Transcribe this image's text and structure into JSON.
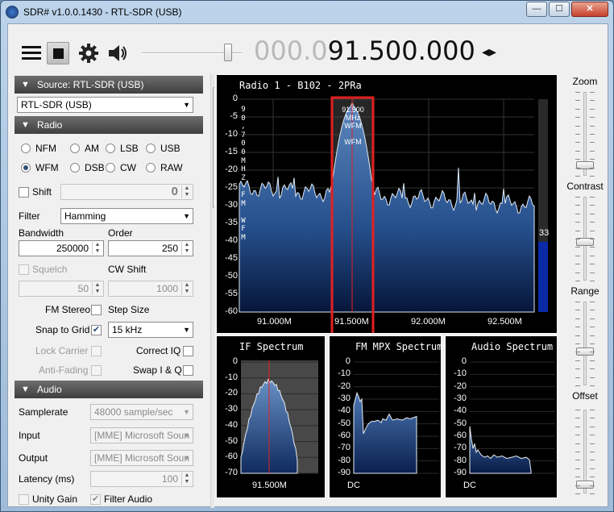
{
  "window": {
    "title": "SDR# v1.0.0.1430 - RTL-SDR (USB)"
  },
  "toolbar": {
    "freq_dim": "000.0",
    "freq_bright": "91.500.000",
    "freq_arrows": "◂▸"
  },
  "source": {
    "header": "Source: RTL-SDR (USB)",
    "device": "RTL-SDR (USB)"
  },
  "radio": {
    "header": "Radio",
    "modes": [
      "NFM",
      "AM",
      "LSB",
      "USB",
      "WFM",
      "DSB",
      "CW",
      "RAW"
    ],
    "selected_mode": "WFM",
    "shift_label": "Shift",
    "shift_value": "0",
    "filter_label": "Filter",
    "filter_value": "Hamming",
    "bandwidth_label": "Bandwidth",
    "bandwidth_value": "250000",
    "order_label": "Order",
    "order_value": "250",
    "squelch_label": "Squelch",
    "squelch_value": "50",
    "cwshift_label": "CW Shift",
    "cwshift_value": "1000",
    "fmstereo_label": "FM Stereo",
    "stepsize_label": "Step Size",
    "snap_label": "Snap to Grid",
    "stepsize_value": "15 kHz",
    "lockcarrier_label": "Lock Carrier",
    "correctiq_label": "Correct IQ",
    "antifading_label": "Anti-Fading",
    "swapiq_label": "Swap I & Q"
  },
  "audio": {
    "header": "Audio",
    "samplerate_label": "Samplerate",
    "samplerate_value": "48000 sample/sec",
    "input_label": "Input",
    "input_value": "[MME] Microsoft Soun",
    "output_label": "Output",
    "output_value": "[MME] Microsoft Soun",
    "latency_label": "Latency (ms)",
    "latency_value": "100",
    "unitygain_label": "Unity Gain",
    "filteraudio_label": "Filter Audio"
  },
  "main_spectrum": {
    "title": "Radio 1  - B102 - 2PRa",
    "y_ticks": [
      "0",
      "-5",
      "-10",
      "-15",
      "-20",
      "-25",
      "-30",
      "-35",
      "-40",
      "-45",
      "-50",
      "-55",
      "-60"
    ],
    "x_ticks": [
      "91.000M",
      "91.500M",
      "92.000M",
      "92.500M"
    ],
    "side_text": [
      "9",
      "0",
      ",",
      "7",
      "0",
      "0",
      "M",
      "H",
      "Z",
      "-",
      "F",
      "M",
      " ",
      "W",
      "F",
      "M"
    ],
    "marker_lines": [
      "91.500",
      "MHz",
      "WFM",
      "",
      "WFM"
    ],
    "level_value": "33",
    "level_fraction": 0.33
  },
  "if_spectrum": {
    "title": "IF Spectrum",
    "y_ticks": [
      "0",
      "-10",
      "-20",
      "-30",
      "-40",
      "-50",
      "-60",
      "-70"
    ],
    "x_label": "91.500M"
  },
  "mpx_spectrum": {
    "title": "FM MPX Spectrum",
    "y_ticks": [
      "0",
      "-10",
      "-20",
      "-30",
      "-40",
      "-50",
      "-60",
      "-70",
      "-80",
      "-90"
    ],
    "x_label": "DC"
  },
  "audio_spectrum": {
    "title": "Audio Spectrum",
    "y_ticks": [
      "0",
      "-10",
      "-20",
      "-30",
      "-40",
      "-50",
      "-60",
      "-70",
      "-80",
      "-90"
    ],
    "x_label": "DC"
  },
  "sliders": {
    "zoom": "Zoom",
    "contrast": "Contrast",
    "range": "Range",
    "offset": "Offset"
  },
  "colors": {
    "accent_red": "#e32020",
    "spectrum_blue": "#3f6ea8",
    "header_dark": "#3f3f3f"
  }
}
